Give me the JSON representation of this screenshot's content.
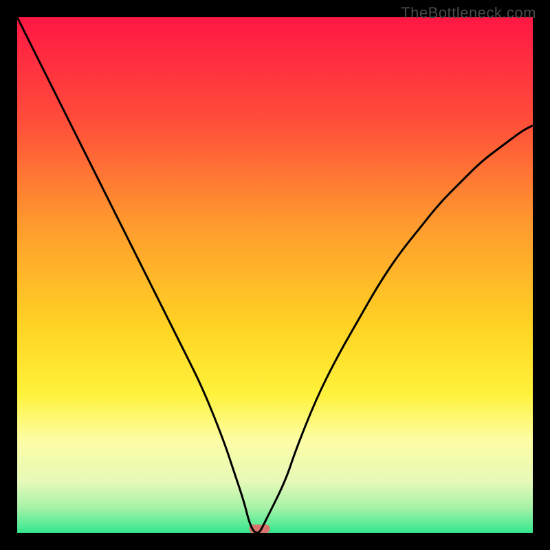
{
  "watermark": "TheBottleneck.com",
  "chart_data": {
    "type": "line",
    "title": "",
    "xlabel": "",
    "ylabel": "",
    "xlim": [
      0,
      100
    ],
    "ylim": [
      0,
      100
    ],
    "series": [
      {
        "name": "curve",
        "x": [
          0,
          4,
          8,
          12,
          16,
          20,
          24,
          28,
          32,
          36,
          40,
          42,
          44,
          45,
          46,
          47,
          48,
          52,
          54,
          58,
          62,
          66,
          70,
          74,
          78,
          82,
          86,
          90,
          94,
          98,
          100
        ],
        "y": [
          100,
          92,
          84,
          76,
          68,
          60,
          52,
          44,
          36,
          28,
          18,
          12,
          6,
          2,
          0,
          0,
          2,
          10,
          16,
          26,
          34,
          41,
          48,
          54,
          59,
          64,
          68,
          72,
          75,
          78,
          79
        ]
      }
    ],
    "bottleneck_marker": {
      "x_start": 45,
      "x_end": 49,
      "color": "#d9746d"
    },
    "gradient_stops": [
      {
        "offset": 0,
        "color": "#ff1744"
      },
      {
        "offset": 20,
        "color": "#ff4d3a"
      },
      {
        "offset": 40,
        "color": "#ff9a2e"
      },
      {
        "offset": 60,
        "color": "#ffd324"
      },
      {
        "offset": 73,
        "color": "#fff23a"
      },
      {
        "offset": 82,
        "color": "#fdfda5"
      },
      {
        "offset": 90,
        "color": "#e7f9b8"
      },
      {
        "offset": 95,
        "color": "#a8f2a8"
      },
      {
        "offset": 100,
        "color": "#34e88f"
      }
    ]
  }
}
